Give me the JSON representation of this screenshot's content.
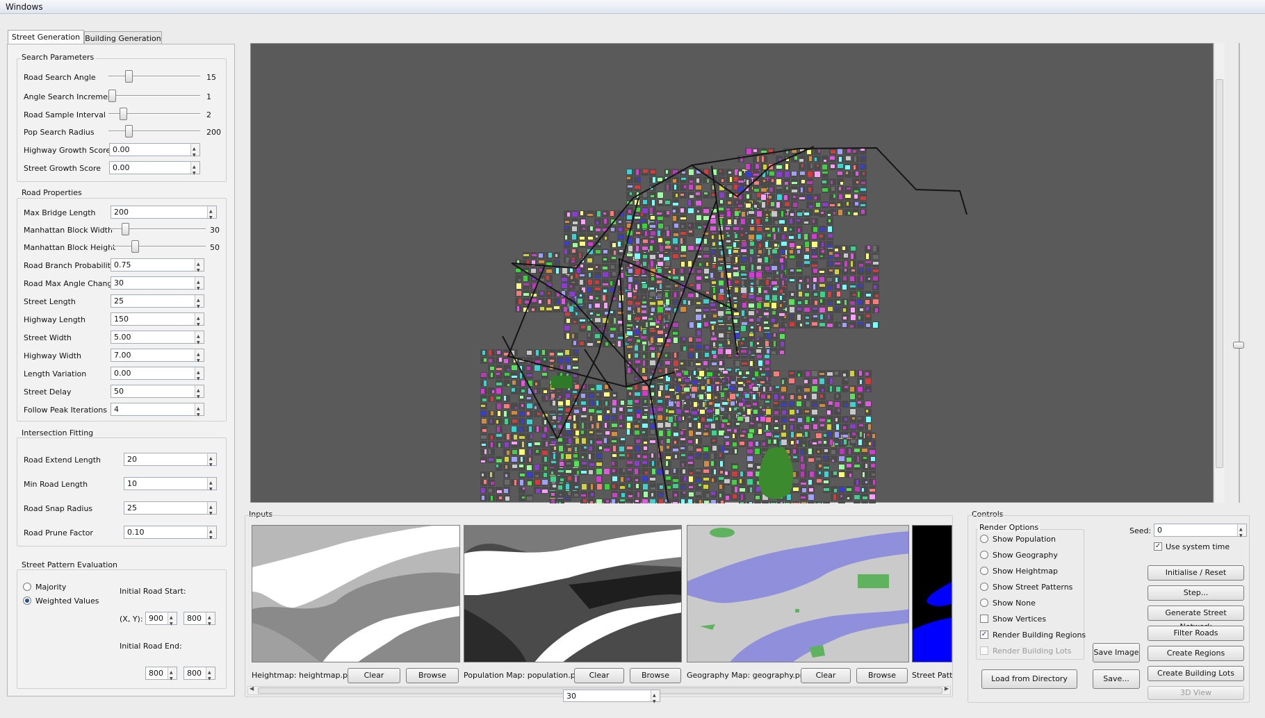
{
  "window": {
    "title": "Windows"
  },
  "tabs": [
    {
      "label": "Street Generation",
      "active": true
    },
    {
      "label": "Building Generation",
      "active": false
    }
  ],
  "search_params": {
    "title": "Search Parameters",
    "road_search_angle": {
      "label": "Road Search Angle",
      "value": "15",
      "fraction": 0.2
    },
    "angle_search_increment": {
      "label": "Angle Search Increment",
      "value": "1",
      "fraction": 0.0
    },
    "road_sample_interval": {
      "label": "Road Sample Interval",
      "value": "2",
      "fraction": 0.13
    },
    "pop_search_radius": {
      "label": "Pop Search Radius",
      "value": "200",
      "fraction": 0.2
    },
    "highway_growth_score": {
      "label": "Highway Growth Score",
      "value": "0.00"
    },
    "street_growth_score": {
      "label": "Street Growth Score",
      "value": "0.00"
    }
  },
  "road_props": {
    "title": "Road Properties",
    "max_bridge_length": {
      "label": "Max Bridge Length",
      "value": "200"
    },
    "manhattan_block_width": {
      "label": "Manhattan Block Width",
      "value": "30",
      "fraction": 0.13
    },
    "manhattan_block_height": {
      "label": "Manhattan Block Height",
      "value": "50",
      "fraction": 0.24
    },
    "road_branch_probability": {
      "label": "Road Branch Probability",
      "value": "0.75"
    },
    "road_max_angle_change": {
      "label": "Road Max Angle Change",
      "value": "30"
    },
    "street_length": {
      "label": "Street Length",
      "value": "25"
    },
    "highway_length": {
      "label": "Highway Length",
      "value": "150"
    },
    "street_width": {
      "label": "Street Width",
      "value": "5.00"
    },
    "highway_width": {
      "label": "Highway Width",
      "value": "7.00"
    },
    "length_variation": {
      "label": "Length Variation",
      "value": "0.00"
    },
    "street_delay": {
      "label": "Street Delay",
      "value": "50"
    },
    "follow_peak_iterations": {
      "label": "Follow Peak Iterations",
      "value": "4"
    }
  },
  "intersection": {
    "title": "Intersection Fitting",
    "road_extend_length": {
      "label": "Road Extend Length",
      "value": "20"
    },
    "min_road_length": {
      "label": "Min Road Length",
      "value": "10"
    },
    "road_snap_radius": {
      "label": "Road Snap Radius",
      "value": "25"
    },
    "road_prune_factor": {
      "label": "Road Prune Factor",
      "value": "0.10"
    }
  },
  "pattern_eval": {
    "title": "Street Pattern Evaluation",
    "majority": "Majority",
    "weighted": "Weighted Values",
    "initial_start": "Initial Road Start:",
    "xy_label": "(X, Y):",
    "start_x": "900",
    "start_y": "800",
    "initial_end": "Initial Road End:",
    "end_x": "800",
    "end_y": "800"
  },
  "inputs": {
    "title": "Inputs",
    "heightmap_label": "Heightmap: heightmap.png",
    "population_label": "Population Map: population.png",
    "geography_label": "Geography Map: geography.png",
    "street_label": "Street Patte",
    "clear": "Clear",
    "browse": "Browse",
    "scroll_value": "30"
  },
  "controls": {
    "title": "Controls",
    "render_options": "Render Options",
    "show_population": "Show Population",
    "show_geography": "Show Geography",
    "show_heightmap": "Show Heightmap",
    "show_street_patterns": "Show Street Patterns",
    "show_none": "Show None",
    "show_vertices": "Show Vertices",
    "render_building_regions": "Render Building Regions",
    "render_building_lots": "Render Building Lots",
    "seed_label": "Seed:",
    "seed_value": "0",
    "use_system_time": "Use system time",
    "initialise": "Initialise / Reset",
    "step": "Step...",
    "generate": "Generate Street Network",
    "filter": "Filter Roads",
    "create_regions": "Create Regions",
    "create_lots": "Create Building Lots",
    "view_3d": "3D View",
    "save_image": "Save Image",
    "save": "Save...",
    "load_dir": "Load from Directory"
  },
  "colors": {
    "viewport_bg": "#5a5a5a",
    "water_blue": "#8f8fdb",
    "park_green": "#3c8a2e"
  }
}
